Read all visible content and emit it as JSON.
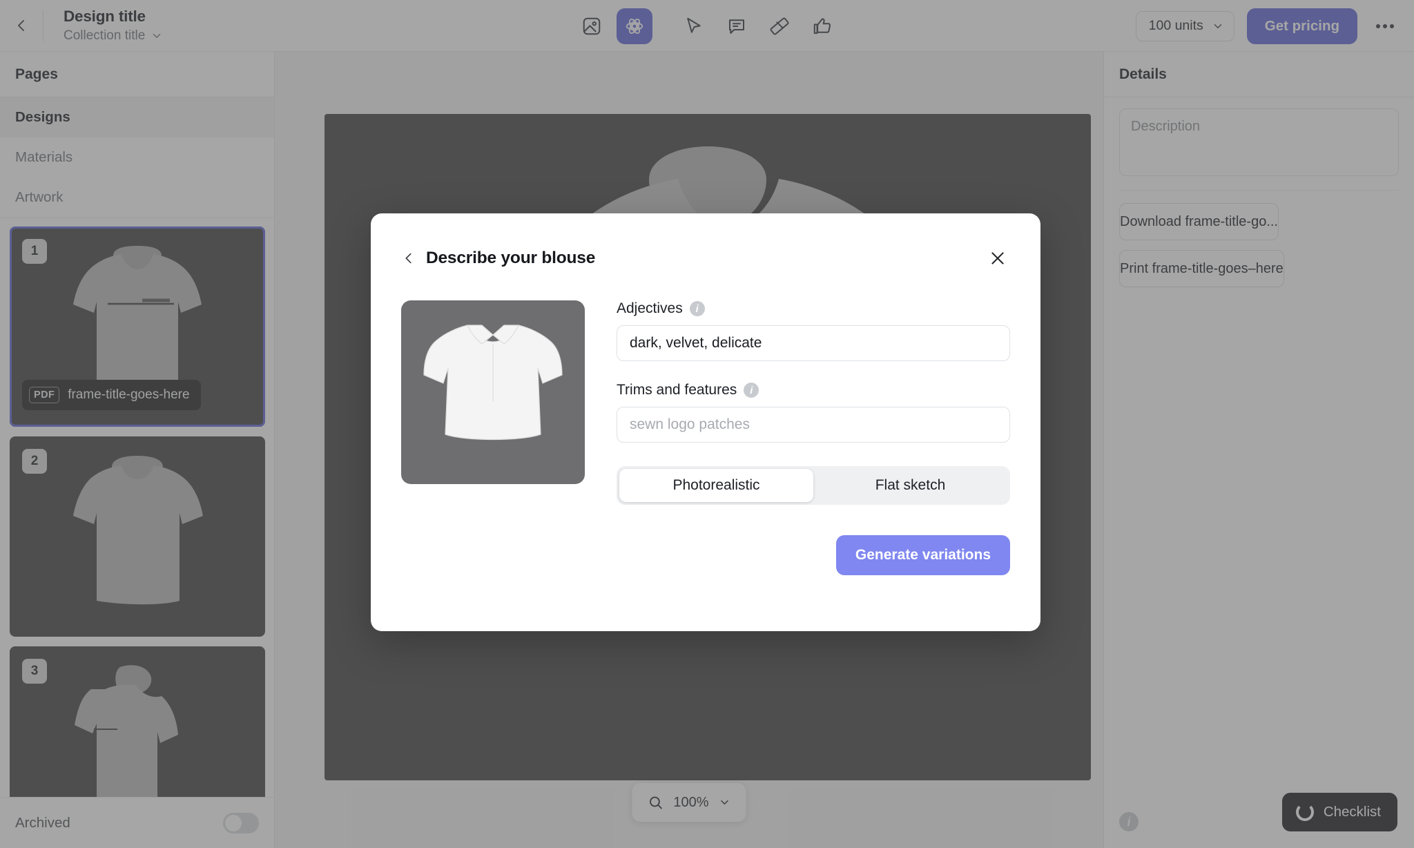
{
  "topbar": {
    "back_icon": "chevron-left-icon",
    "title": "Design title",
    "subtitle": "Collection title",
    "subtitle_chevron": "chevron-down-icon",
    "tools": [
      {
        "name": "image-icon",
        "label": "Image",
        "active": false
      },
      {
        "name": "ai-atom-icon",
        "label": "AI",
        "active": true
      },
      {
        "name": "cursor-pointer-icon",
        "label": "Select",
        "active": false
      },
      {
        "name": "comment-icon",
        "label": "Comment",
        "active": false
      },
      {
        "name": "ruler-icon",
        "label": "Measure",
        "active": false
      },
      {
        "name": "thumbs-up-icon",
        "label": "Approve",
        "active": false
      }
    ],
    "units_value": "100 units",
    "pricing_label": "Get pricing",
    "kebab_label": "More options"
  },
  "sidebar": {
    "header": "Pages",
    "items": [
      {
        "label": "Designs",
        "selected": true
      },
      {
        "label": "Materials",
        "selected": false
      },
      {
        "label": "Artwork",
        "selected": false
      }
    ],
    "thumbnails": [
      {
        "number": "1",
        "selected": true,
        "badge_type": "PDF",
        "badge_label": "frame-title-goes-here"
      },
      {
        "number": "2",
        "selected": false
      },
      {
        "number": "3",
        "selected": false
      }
    ],
    "footer_label": "Archived",
    "footer_toggle_on": false
  },
  "canvas": {
    "zoom_icon": "search-icon",
    "zoom_value": "100%",
    "zoom_chevron": "chevron-down-icon"
  },
  "details": {
    "header": "Details",
    "description_placeholder": "Description",
    "description_value": "",
    "download_label": "Download frame-title-go...",
    "print_label": "Print frame-title-goes–here",
    "info_icon": "info-icon",
    "checklist_label": "Checklist",
    "checklist_icon": "progress-ring-icon"
  },
  "modal": {
    "back_icon": "chevron-left-icon",
    "title": "Describe your blouse",
    "close_icon": "close-icon",
    "thumbnail_alt": "white-blouse-preview",
    "fields": [
      {
        "label": "Adjectives",
        "info_icon": "info-icon",
        "value": "dark, velvet, delicate",
        "placeholder": ""
      },
      {
        "label": "Trims and features",
        "info_icon": "info-icon",
        "value": "",
        "placeholder": "sewn logo patches"
      }
    ],
    "segmented": [
      {
        "label": "Photorealistic",
        "selected": true
      },
      {
        "label": "Flat sketch",
        "selected": false
      }
    ],
    "submit_label": "Generate variations"
  },
  "colors": {
    "accent": "#5c63d8",
    "accent_light": "#8087f0",
    "canvas_bg": "#3c3c3e",
    "dark_pill": "#17181b"
  }
}
